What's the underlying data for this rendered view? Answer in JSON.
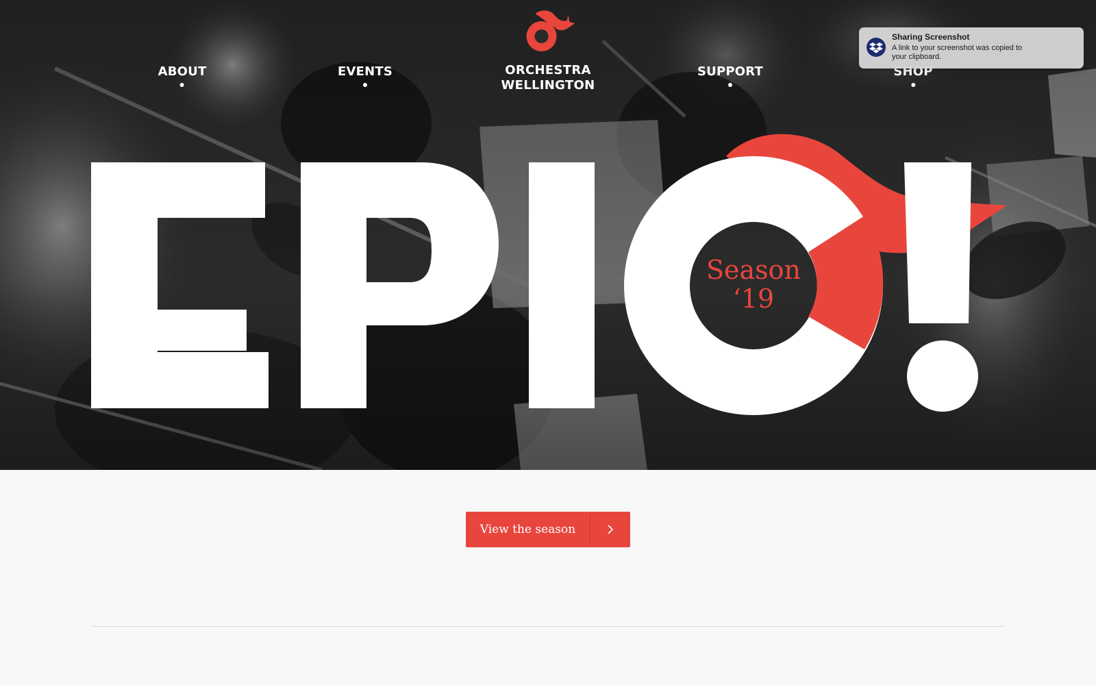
{
  "nav": {
    "items": [
      {
        "label": "ABOUT"
      },
      {
        "label": "EVENTS"
      },
      {
        "label": "SUPPORT"
      },
      {
        "label": "SHOP"
      }
    ],
    "brand_name": "ORCHESTRA\nWELLINGTON",
    "brand_icon": "orchestra-wellington-logo-icon"
  },
  "hero": {
    "headline": "EPIC!",
    "season_line1": "Season",
    "season_line2": "‘19"
  },
  "notification": {
    "title": "Sharing Screenshot",
    "body": "A link to your screenshot was copied to your clipboard.",
    "icon": "dropbox-icon"
  },
  "cta": {
    "label": "View the season",
    "icon": "chevron-right-icon"
  },
  "colors": {
    "accent": "#e8463d",
    "hero_text": "#ffffff",
    "page_bg": "#f8f8f8"
  }
}
